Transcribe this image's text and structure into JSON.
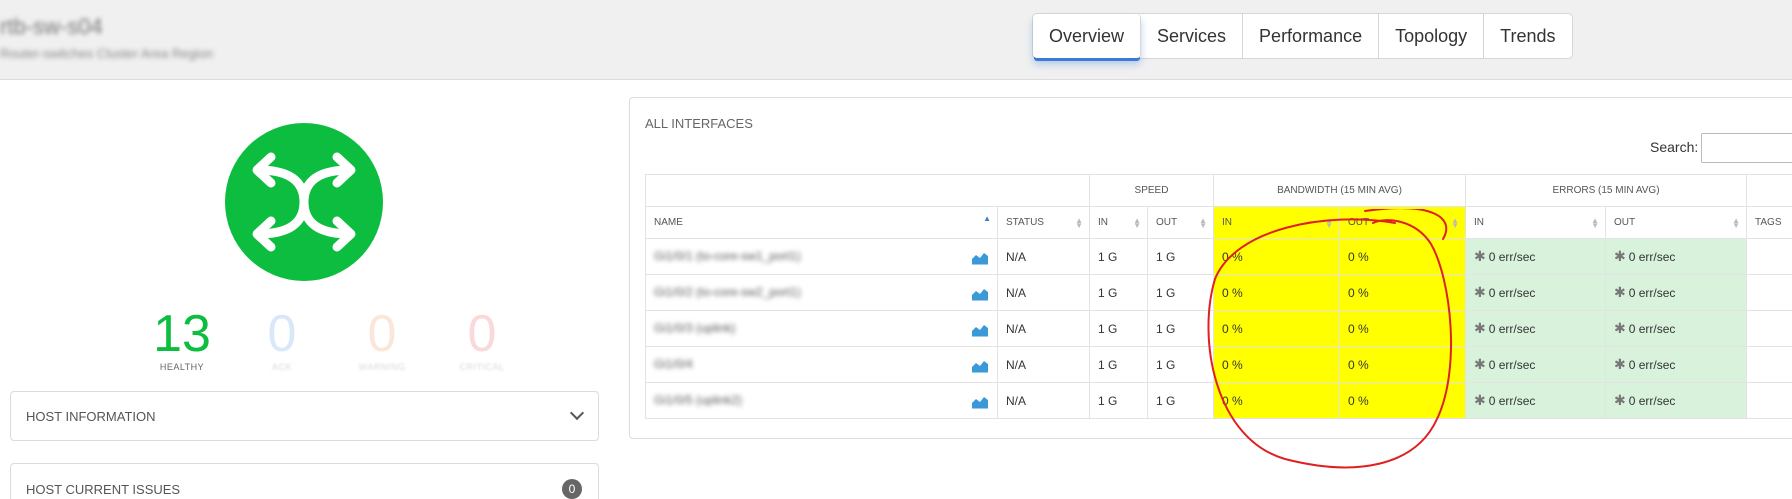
{
  "header": {
    "host_title": "rtb-sw-s04",
    "host_subtitle": "Router-switches  Cluster  Area  Region"
  },
  "tabs": [
    {
      "label": "Overview",
      "active": true
    },
    {
      "label": "Services"
    },
    {
      "label": "Performance"
    },
    {
      "label": "Topology"
    },
    {
      "label": "Trends"
    }
  ],
  "status": {
    "icon": "switch-crossing-arrows-icon",
    "color": "#0cbd3f",
    "counts": [
      {
        "value": "13",
        "label": "HEALTHY"
      },
      {
        "value": "0",
        "label": "ACK"
      },
      {
        "value": "0",
        "label": "WARNING"
      },
      {
        "value": "0",
        "label": "CRITICAL"
      }
    ]
  },
  "panels": {
    "host_information": "HOST INFORMATION",
    "host_current_issues": "HOST CURRENT ISSUES",
    "issues_count": "0"
  },
  "interfaces": {
    "title": "ALL INTERFACES",
    "search_label": "Search:",
    "search_value": "",
    "group_headers": {
      "speed": "SPEED",
      "bandwidth": "BANDWIDTH (15 MIN AVG)",
      "errors": "ERRORS (15 MIN AVG)"
    },
    "columns": {
      "name": "NAME",
      "status": "STATUS",
      "speed_in": "IN",
      "speed_out": "OUT",
      "bw_in": "IN",
      "bw_out": "OUT",
      "err_in": "IN",
      "err_out": "OUT",
      "tags": "TAGS"
    },
    "rows": [
      {
        "name": "Gi1/0/1 (to-core-sw1_port1)",
        "status": "N/A",
        "speed_in": "1 G",
        "speed_out": "1 G",
        "bw_in": "0 %",
        "bw_out": "0 %",
        "err_in": "0 err/sec",
        "err_out": "0 err/sec"
      },
      {
        "name": "Gi1/0/2 (to-core-sw2_port1)",
        "status": "N/A",
        "speed_in": "1 G",
        "speed_out": "1 G",
        "bw_in": "0 %",
        "bw_out": "0 %",
        "err_in": "0 err/sec",
        "err_out": "0 err/sec"
      },
      {
        "name": "Gi1/0/3 (uplink)",
        "status": "N/A",
        "speed_in": "1 G",
        "speed_out": "1 G",
        "bw_in": "0 %",
        "bw_out": "0 %",
        "err_in": "0 err/sec",
        "err_out": "0 err/sec"
      },
      {
        "name": "Gi1/0/4",
        "status": "N/A",
        "speed_in": "1 G",
        "speed_out": "1 G",
        "bw_in": "0 %",
        "bw_out": "0 %",
        "err_in": "0 err/sec",
        "err_out": "0 err/sec"
      },
      {
        "name": "Gi1/0/5 (uplink2)",
        "status": "N/A",
        "speed_in": "1 G",
        "speed_out": "1 G",
        "bw_in": "0 %",
        "bw_out": "0 %",
        "err_in": "0 err/sec",
        "err_out": "0 err/sec"
      }
    ]
  },
  "colors": {
    "highlight": "#ffff00",
    "annotation": "#e02020",
    "error_ok": "#d9f2dc",
    "healthy": "#0cbd3f",
    "chart_icon": "#3a9ad9"
  }
}
